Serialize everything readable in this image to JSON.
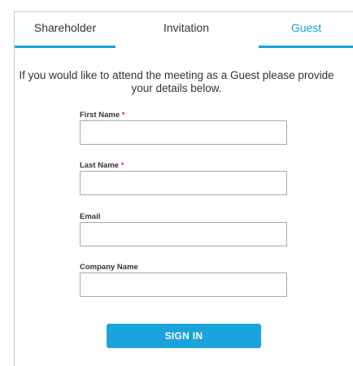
{
  "tabs": {
    "shareholder": "Shareholder",
    "invitation": "Invitation",
    "guest": "Guest",
    "active": "Guest"
  },
  "intro": {
    "line1": "If you would like to attend the meeting as a Guest please provide",
    "line2": "your details below."
  },
  "form": {
    "required_mark": "*",
    "first_name": {
      "label": "First Name",
      "required": true,
      "value": ""
    },
    "last_name": {
      "label": "Last Name",
      "required": true,
      "value": ""
    },
    "email": {
      "label": "Email",
      "required": false,
      "value": ""
    },
    "company_name": {
      "label": "Company Name",
      "required": false,
      "value": ""
    },
    "submit_label": "SIGN IN"
  },
  "colors": {
    "accent": "#1aa3dc",
    "required": "#e1262d",
    "text": "#333333"
  }
}
